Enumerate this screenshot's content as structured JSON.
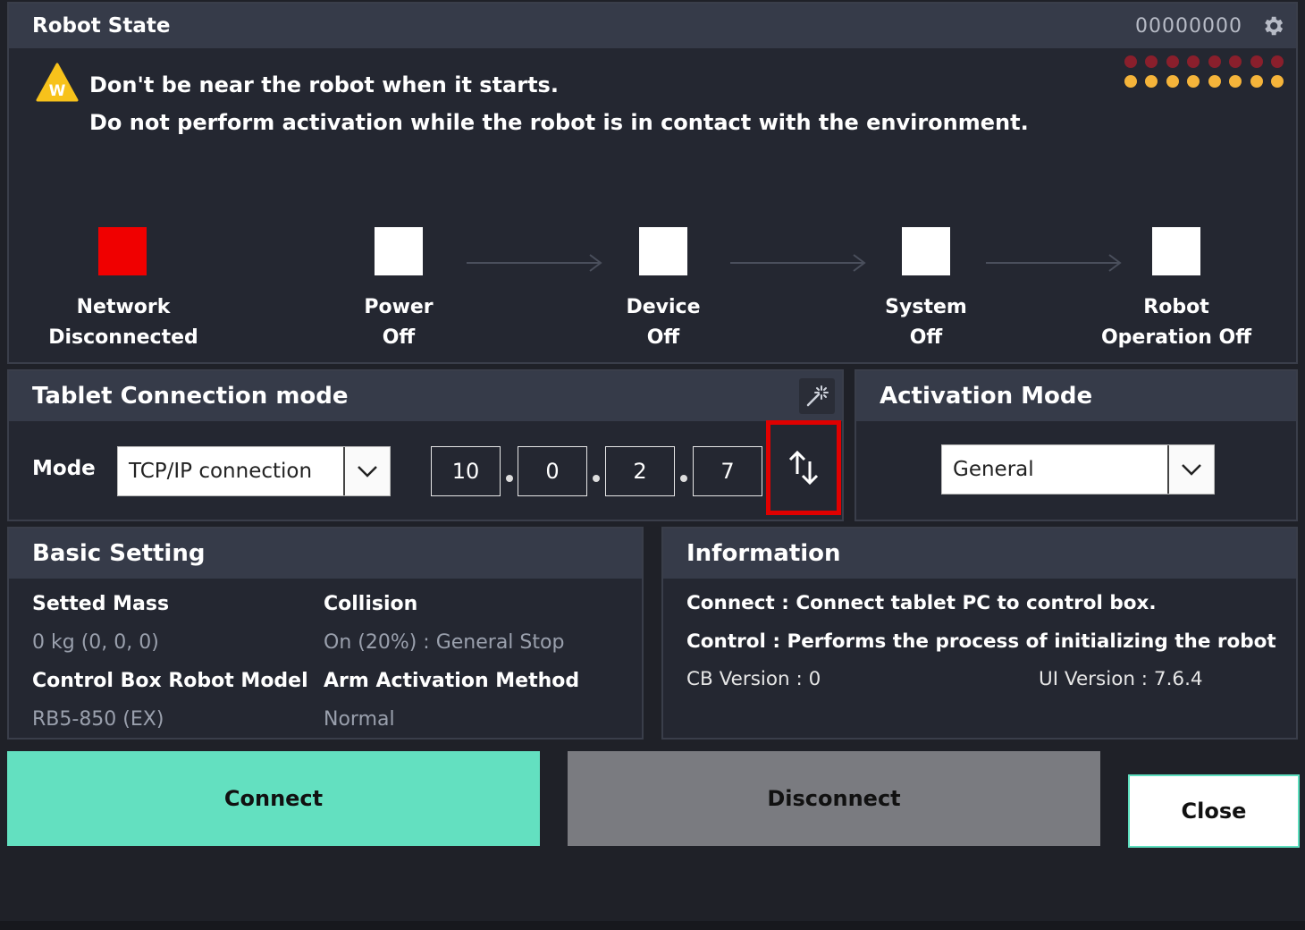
{
  "robot_state": {
    "title": "Robot State",
    "serial": "00000000",
    "warning_line1": "Don't be near the robot when it starts.",
    "warning_line2": "Do not perform activation while the robot is in contact with the environment.",
    "warning_icon_letter": "W",
    "steps": [
      {
        "line1": "Network",
        "line2": "Disconnected",
        "color": "#f00000"
      },
      {
        "line1": "Power",
        "line2": "Off",
        "color": "#ffffff"
      },
      {
        "line1": "Device",
        "line2": "Off",
        "color": "#ffffff"
      },
      {
        "line1": "System",
        "line2": "Off",
        "color": "#ffffff"
      },
      {
        "line1": "Robot",
        "line2": "Operation Off",
        "color": "#ffffff"
      }
    ],
    "indicator_colors": {
      "red": "#8a1f2c",
      "yellow": "#f5b43a"
    }
  },
  "tablet_connection": {
    "title": "Tablet Connection mode",
    "mode_label": "Mode",
    "mode_value": "TCP/IP connection",
    "ip": [
      "10",
      "0",
      "2",
      "7"
    ]
  },
  "activation_mode": {
    "title": "Activation Mode",
    "value": "General"
  },
  "basic_setting": {
    "title": "Basic Setting",
    "setted_mass_label": "Setted Mass",
    "setted_mass_value": "0 kg (0, 0, 0)",
    "collision_label": "Collision",
    "collision_value": "On (20%) : General Stop",
    "model_label": "Control Box Robot Model",
    "model_value": "RB5-850 (EX)",
    "arm_method_label": "Arm Activation Method",
    "arm_method_value": "Normal"
  },
  "information": {
    "title": "Information",
    "connect_line": "Connect : Connect tablet PC to control box.",
    "control_line": "Control : Performs the process of initializing the robot",
    "cb_version": "CB Version : 0",
    "ui_version": "UI Version : 7.6.4"
  },
  "buttons": {
    "connect": "Connect",
    "disconnect": "Disconnect",
    "close": "Close"
  },
  "colors": {
    "connect": "#63e0c0",
    "disconnect": "#7a7b80",
    "highlight": "#e00000"
  }
}
